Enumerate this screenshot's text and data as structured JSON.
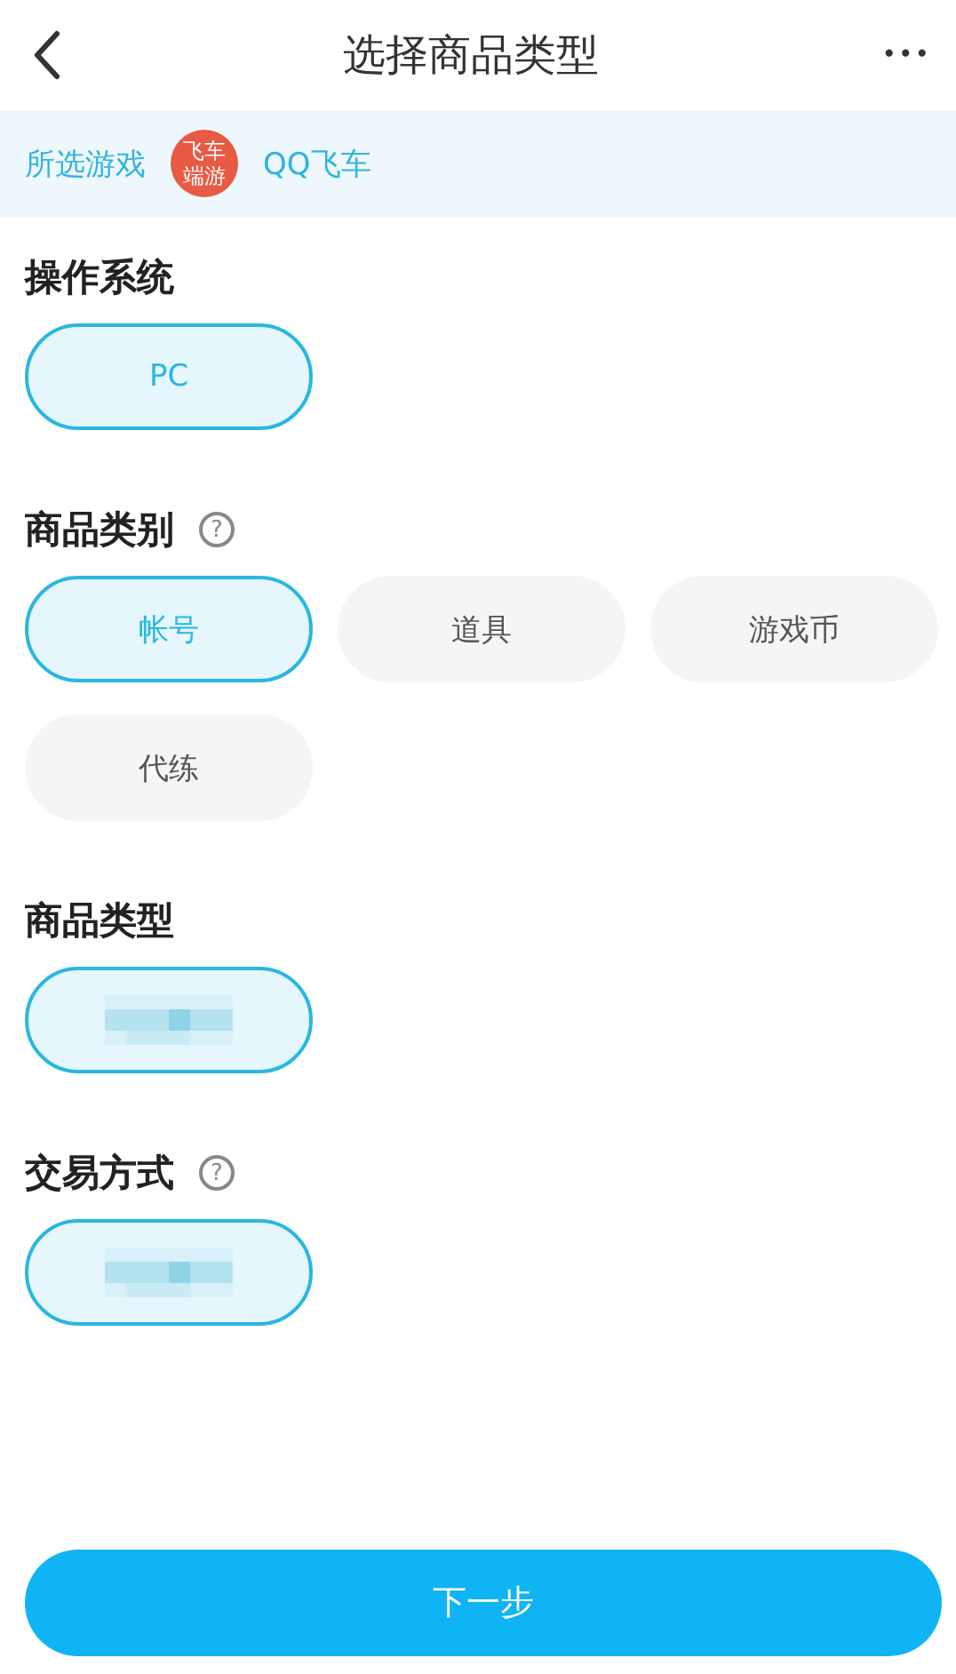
{
  "header": {
    "title": "选择商品类型",
    "more": "•••"
  },
  "game": {
    "label": "所选游戏",
    "logo_lines": [
      "飞车",
      "端游"
    ],
    "name": "QQ飞车"
  },
  "sections": [
    {
      "title": "操作系统",
      "options": [
        {
          "kind": "text",
          "label": "PC",
          "selected": true
        }
      ]
    },
    {
      "title": "商品类别",
      "help": "?",
      "options": [
        {
          "kind": "text",
          "label": "帐号",
          "selected": true
        },
        {
          "kind": "text",
          "label": "道具",
          "selected": false
        },
        {
          "kind": "text",
          "label": "游戏币",
          "selected": false
        },
        {
          "kind": "text",
          "label": "代练",
          "selected": false
        }
      ]
    },
    {
      "title": "商品类型",
      "options": [
        {
          "kind": "redacted",
          "selected": true
        }
      ]
    },
    {
      "title": "交易方式",
      "help": "?",
      "options": [
        {
          "kind": "redacted",
          "selected": true
        }
      ]
    }
  ],
  "next_button": "下一步"
}
